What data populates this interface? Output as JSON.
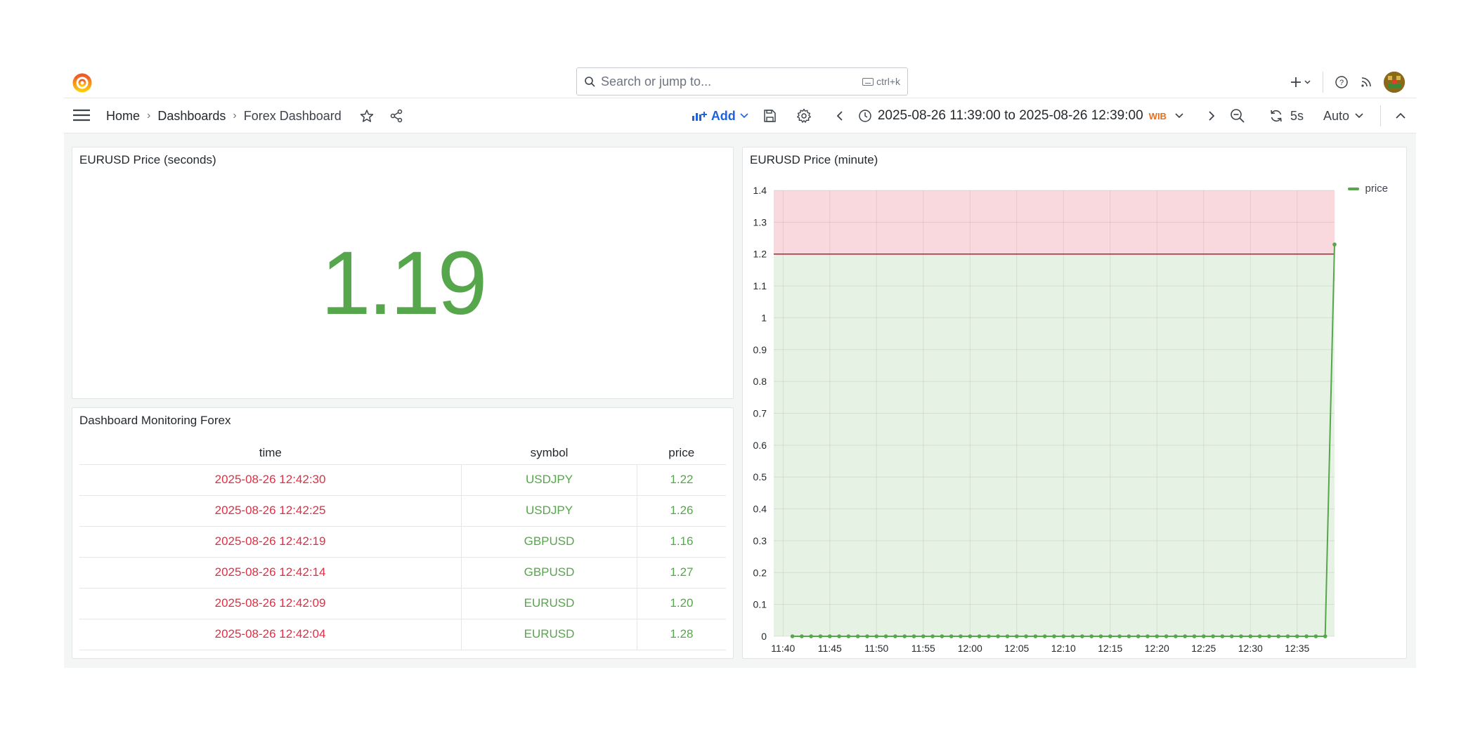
{
  "topbar": {
    "search_placeholder": "Search or jump to...",
    "search_shortcut": "ctrl+k"
  },
  "breadcrumb": [
    "Home",
    "Dashboards",
    "Forex Dashboard"
  ],
  "toolbar": {
    "add_label": "Add",
    "time_range": "2025-08-26 11:39:00 to 2025-08-26 12:39:00",
    "timezone": "WIB",
    "refresh_interval": "5s",
    "auto_label": "Auto"
  },
  "stat_panel": {
    "title": "EURUSD Price (seconds)",
    "value": "1.19",
    "color": "#56a64b"
  },
  "table_panel": {
    "title": "Dashboard Monitoring Forex",
    "columns": [
      "time",
      "symbol",
      "price"
    ],
    "rows": [
      [
        "2025-08-26 12:42:30",
        "USDJPY",
        "1.22"
      ],
      [
        "2025-08-26 12:42:25",
        "USDJPY",
        "1.26"
      ],
      [
        "2025-08-26 12:42:19",
        "GBPUSD",
        "1.16"
      ],
      [
        "2025-08-26 12:42:14",
        "GBPUSD",
        "1.27"
      ],
      [
        "2025-08-26 12:42:09",
        "EURUSD",
        "1.20"
      ],
      [
        "2025-08-26 12:42:04",
        "EURUSD",
        "1.28"
      ]
    ]
  },
  "chart_panel": {
    "title": "EURUSD Price (minute)"
  },
  "chart_data": {
    "type": "line",
    "title": "EURUSD Price (minute)",
    "xlabel": "",
    "ylabel": "",
    "ylim": [
      0,
      1.4
    ],
    "yticks": [
      "0",
      "0.1",
      "0.2",
      "0.3",
      "0.4",
      "0.5",
      "0.6",
      "0.7",
      "0.8",
      "0.9",
      "1",
      "1.1",
      "1.2",
      "1.3",
      "1.4"
    ],
    "xticks": [
      "11:40",
      "11:45",
      "11:50",
      "11:55",
      "12:00",
      "12:05",
      "12:10",
      "12:15",
      "12:20",
      "12:25",
      "12:30",
      "12:35"
    ],
    "threshold": 1.2,
    "threshold_colors": {
      "below": "#56a64b",
      "above": "#e02f44"
    },
    "grid": true,
    "legend_position": "top-right",
    "series": [
      {
        "name": "price",
        "color": "#56a64b",
        "x_minutes": "11:41 to 12:38 every minute, then 12:39",
        "values_note": "",
        "values": [
          0,
          0,
          0,
          0,
          0,
          0,
          0,
          0,
          0,
          0,
          0,
          0,
          0,
          0,
          0,
          0,
          0,
          0,
          0,
          0,
          0,
          0,
          0,
          0,
          0,
          0,
          0,
          0,
          0,
          0,
          0,
          0,
          0,
          0,
          0,
          0,
          0,
          0,
          0,
          0,
          0,
          0,
          0,
          0,
          0,
          0,
          0,
          0,
          0,
          0,
          0,
          0,
          0,
          0,
          0,
          0,
          0,
          0,
          1.23
        ]
      }
    ]
  }
}
